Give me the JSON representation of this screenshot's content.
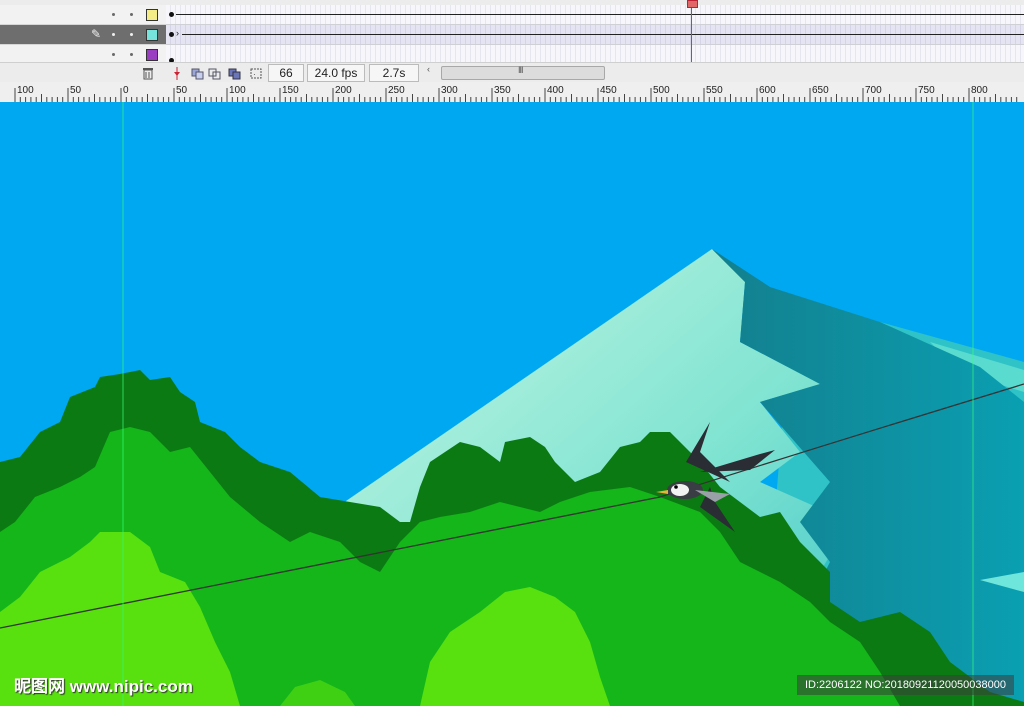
{
  "timeline": {
    "layers": [
      {
        "swatch_color": "#f4ec86",
        "active": false,
        "locked_icon": false
      },
      {
        "swatch_color": "#76e3dc",
        "active": true,
        "locked_icon": true
      },
      {
        "swatch_color": "#9a3ec2",
        "active": false,
        "locked_icon": false
      }
    ],
    "current_frame": "66",
    "frame_rate": "24.0 fps",
    "elapsed_time": "2.7s",
    "scroll_grip": "III",
    "scroll_left_arrow": "‹"
  },
  "ruler": {
    "labels": [
      "100",
      "50",
      "0",
      "50",
      "100",
      "150",
      "200",
      "250",
      "300",
      "350",
      "400",
      "450",
      "500",
      "550",
      "600",
      "650",
      "700",
      "750",
      "800"
    ]
  },
  "stage": {
    "sky_color": "#00a8f2",
    "mountain_color": "#a8f0d6",
    "foliage_dark": "#0c7a12",
    "foliage_mid": "#14b61a",
    "foliage_light": "#58e00f",
    "guide_color": "#33ff77"
  },
  "watermark": {
    "site": "昵图网 www.nipic.com",
    "id_text": "ID:2206122 NO:20180921120050038000"
  }
}
